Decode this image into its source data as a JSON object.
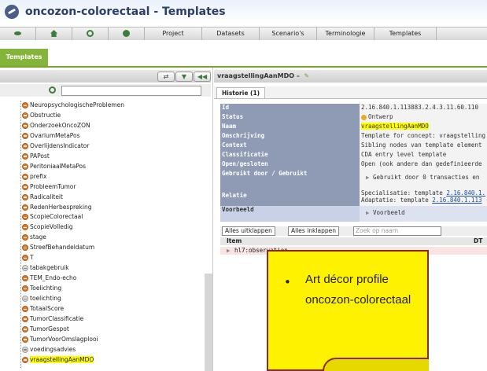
{
  "app": {
    "title": "oncozon-colorectaal - Templates"
  },
  "menu": {
    "items": [
      "Project",
      "Datasets",
      "Scenario's",
      "Terminologie",
      "Templates"
    ]
  },
  "tabs": {
    "active": "Templates"
  },
  "left_panel": {
    "tree": [
      {
        "label": "NeuropsychologischeProblemen",
        "icon": "orange"
      },
      {
        "label": "Obstructie",
        "icon": "orange"
      },
      {
        "label": "OnderzoekOncoZON",
        "icon": "orange"
      },
      {
        "label": "OvariumMetaPos",
        "icon": "orange"
      },
      {
        "label": "OverlijdensIndicator",
        "icon": "orange"
      },
      {
        "label": "PAPost",
        "icon": "orange"
      },
      {
        "label": "PeritoniaalMetaPos",
        "icon": "orange"
      },
      {
        "label": "prefix",
        "icon": "orange"
      },
      {
        "label": "ProbleemTumor",
        "icon": "orange"
      },
      {
        "label": "Radicaliteit",
        "icon": "orange"
      },
      {
        "label": "RedenHerbespreking",
        "icon": "orange"
      },
      {
        "label": "ScopieColorectaal",
        "icon": "orange"
      },
      {
        "label": "ScopieVolledig",
        "icon": "orange"
      },
      {
        "label": "stage",
        "icon": "orange"
      },
      {
        "label": "StreefBehandeldatum",
        "icon": "orange"
      },
      {
        "label": "T",
        "icon": "orange"
      },
      {
        "label": "tabakgebruik",
        "icon": "grey"
      },
      {
        "label": "TEM_Endo-echo",
        "icon": "orange"
      },
      {
        "label": "Toelichting",
        "icon": "orange"
      },
      {
        "label": "toelichting",
        "icon": "grey"
      },
      {
        "label": "TotaalScore",
        "icon": "orange"
      },
      {
        "label": "TumorClassificatie",
        "icon": "orange"
      },
      {
        "label": "TumorGespot",
        "icon": "orange"
      },
      {
        "label": "TumorVoorOmslagplooi",
        "icon": "orange"
      },
      {
        "label": "voedingsadvies",
        "icon": "grey"
      },
      {
        "label": "vraagstellingAanMDO",
        "icon": "orange",
        "selected": true
      }
    ]
  },
  "right_panel": {
    "header": "vraagstellingAanMDO –",
    "history_tab": "Historie (1)",
    "props": {
      "id_k": "Id",
      "id_v": "2.16.840.1.113883.2.4.3.11.60.110",
      "status_k": "Status",
      "status_v": "Ontwerp",
      "naam_k": "Naam",
      "naam_v": "vraagstellingAanMDO",
      "omschrijving_k": "Omschrijving",
      "omschrijving_v": "Template for concept: vraagstelling",
      "context_k": "Context",
      "context_v": "Sibling nodes van template element",
      "classificatie_k": "Classificatie",
      "classificatie_v": "CDA entry level template",
      "open_k": "Open/gesloten",
      "open_v": "Open (ook andere dan gedefinieerde",
      "gebruikt_k": "Gebruikt door / Gebruikt",
      "gebruikt_v": "Gebruikt door 0 transacties en",
      "relatie_k": "Relatie",
      "relatie_v1_prefix": "Specialisatie: template ",
      "relatie_v1_link": "2.16.840.1.",
      "relatie_v2_prefix": "Adaptatie: template ",
      "relatie_v2_link": "2.16.840.1.113",
      "voorbeeld_k": "Voorbeeld",
      "voorbeeld_v": "Voorbeeld"
    },
    "controls": {
      "expand_all": "Alles uitklappen",
      "collapse_all": "Alles inklappen",
      "search_placeholder": "Zoek op naam"
    },
    "grid": {
      "col_item": "Item",
      "col_dt": "DT",
      "row1": "hl7:observation"
    }
  },
  "note": {
    "text": "Art décor profile oncozon-colorectaal"
  },
  "colors": {
    "accent_green": "#85b43a",
    "highlight": "#ffff00",
    "note_bg": "#fff200",
    "note_border": "#8a2a2a"
  }
}
